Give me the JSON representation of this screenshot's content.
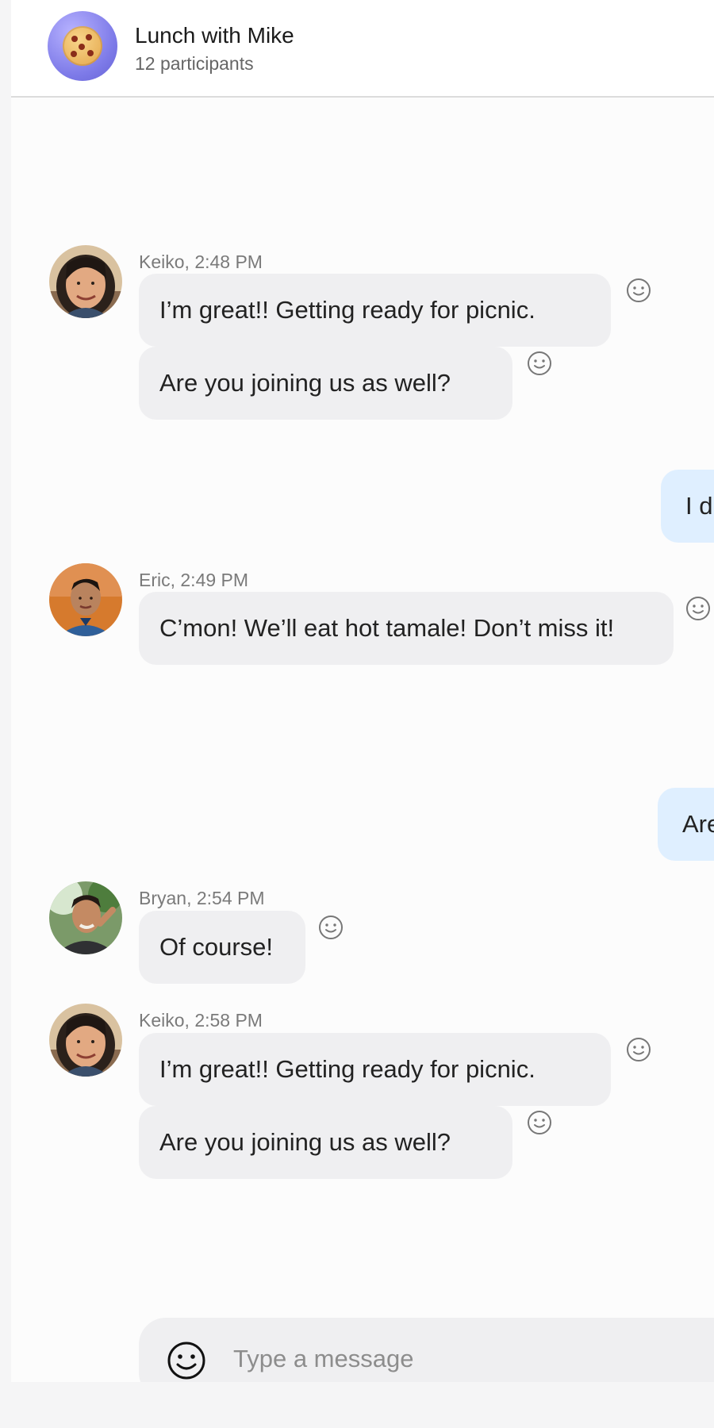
{
  "conversation": {
    "title": "Lunch with Mike",
    "participants": "12 participants"
  },
  "messages": [
    {
      "sender_meta": "Keiko, 2:48 PM",
      "bubbles": [
        "I’m great!! Getting ready for picnic.",
        "Are you joining us as well?"
      ]
    },
    {
      "outgoing": "I d"
    },
    {
      "sender_meta": "Eric, 2:49 PM",
      "bubbles": [
        "C’mon! We’ll eat hot tamale! Don’t miss it!"
      ]
    },
    {
      "outgoing": "Are"
    },
    {
      "sender_meta": "Bryan, 2:54 PM",
      "bubbles": [
        "Of course!"
      ]
    },
    {
      "sender_meta": "Keiko, 2:58 PM",
      "bubbles": [
        "I’m great!! Getting ready for picnic.",
        "Are you joining us as well?"
      ]
    }
  ],
  "composer": {
    "placeholder": "Type a message"
  },
  "icons": {
    "group_avatar": "cookie-icon",
    "reaction": "smiley-icon",
    "composer_emoji": "emoji-picker-icon"
  },
  "colors": {
    "incoming_bubble": "#efeff1",
    "outgoing_bubble": "#dfefff",
    "group_avatar": "#7d7ae8"
  }
}
